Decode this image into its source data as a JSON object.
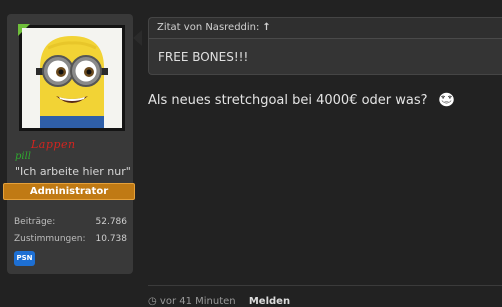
{
  "user": {
    "name_line1": "Lappen",
    "name_line2": "pill",
    "title": "\"Ich arbeite hier nur\"",
    "role": "Administrator",
    "stats": [
      {
        "label": "Beiträge:",
        "value": "52.786"
      },
      {
        "label": "Zustimmungen:",
        "value": "10.738"
      }
    ],
    "badge": "PSN",
    "colors": {
      "name": "#d4241f",
      "role_badge": "#c07a14",
      "psn": "#1d6fd3",
      "online": "#6fbf3a"
    }
  },
  "post": {
    "quote_header": "Zitat von Nasreddin:",
    "quote_link_icon": "up-arrow-icon",
    "quote_text": "FREE BONES!!!",
    "message": "Als neues stretchgoal bei 4000€ oder was?",
    "emoji": "trollface-icon",
    "footer_time": "vor 41 Minuten",
    "footer_action": "Melden"
  }
}
